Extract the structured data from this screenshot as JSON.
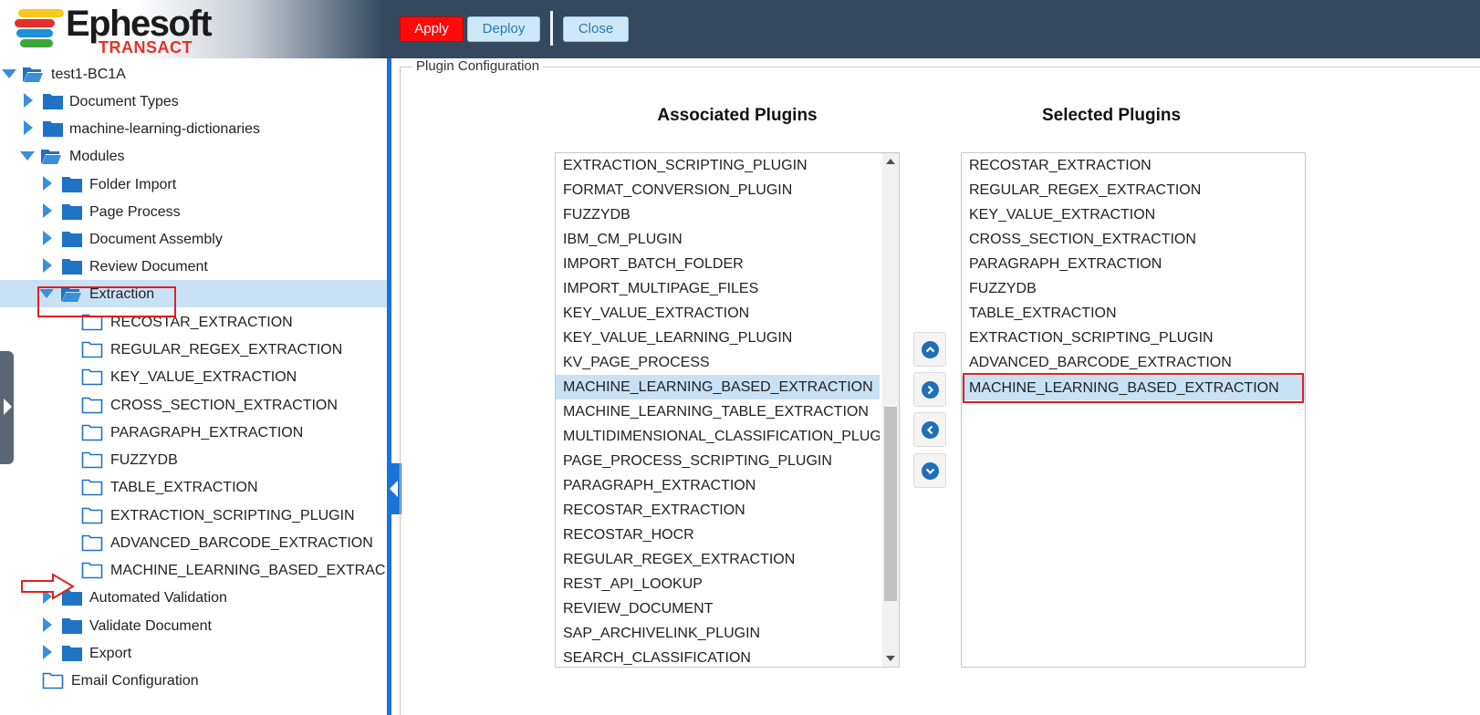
{
  "app": {
    "logo_word": "Ephesoft",
    "logo_sub": "TRANSACT",
    "colors": {
      "header": "#34495e",
      "apply": "#ff0a0a",
      "accent": "#1a73d9",
      "selection": "#c9e1f4",
      "highlight": "#e02020"
    }
  },
  "toolbar": {
    "apply": "Apply",
    "deploy": "Deploy",
    "close": "Close"
  },
  "tree": {
    "root": "test1-BC1A",
    "document_types": "Document Types",
    "ml_dictionaries": "machine-learning-dictionaries",
    "modules": "Modules",
    "folder_import": "Folder Import",
    "page_process": "Page Process",
    "document_assembly": "Document Assembly",
    "review_document": "Review Document",
    "extraction": "Extraction",
    "extraction_children": [
      "RECOSTAR_EXTRACTION",
      "REGULAR_REGEX_EXTRACTION",
      "KEY_VALUE_EXTRACTION",
      "CROSS_SECTION_EXTRACTION",
      "PARAGRAPH_EXTRACTION",
      "FUZZYDB",
      "TABLE_EXTRACTION",
      "EXTRACTION_SCRIPTING_PLUGIN",
      "ADVANCED_BARCODE_EXTRACTION",
      "MACHINE_LEARNING_BASED_EXTRAC"
    ],
    "automated_validation": "Automated Validation",
    "validate_document": "Validate Document",
    "export": "Export",
    "email_configuration": "Email Configuration"
  },
  "plugin_config": {
    "legend": "Plugin Configuration",
    "associated_title": "Associated Plugins",
    "selected_title": "Selected Plugins",
    "associated": [
      "EXTRACTION_SCRIPTING_PLUGIN",
      "FORMAT_CONVERSION_PLUGIN",
      "FUZZYDB",
      "IBM_CM_PLUGIN",
      "IMPORT_BATCH_FOLDER",
      "IMPORT_MULTIPAGE_FILES",
      "KEY_VALUE_EXTRACTION",
      "KEY_VALUE_LEARNING_PLUGIN",
      "KV_PAGE_PROCESS",
      "MACHINE_LEARNING_BASED_EXTRACTION",
      "MACHINE_LEARNING_TABLE_EXTRACTION",
      "MULTIDIMENSIONAL_CLASSIFICATION_PLUG",
      "PAGE_PROCESS_SCRIPTING_PLUGIN",
      "PARAGRAPH_EXTRACTION",
      "RECOSTAR_EXTRACTION",
      "RECOSTAR_HOCR",
      "REGULAR_REGEX_EXTRACTION",
      "REST_API_LOOKUP",
      "REVIEW_DOCUMENT",
      "SAP_ARCHIVELINK_PLUGIN",
      "SEARCH_CLASSIFICATION"
    ],
    "selected": [
      "RECOSTAR_EXTRACTION",
      "REGULAR_REGEX_EXTRACTION",
      "KEY_VALUE_EXTRACTION",
      "CROSS_SECTION_EXTRACTION",
      "PARAGRAPH_EXTRACTION",
      "FUZZYDB",
      "TABLE_EXTRACTION",
      "EXTRACTION_SCRIPTING_PLUGIN",
      "ADVANCED_BARCODE_EXTRACTION",
      "MACHINE_LEARNING_BASED_EXTRACTION"
    ],
    "move_buttons": [
      "chevron-up-icon",
      "chevron-right-icon",
      "chevron-left-icon",
      "chevron-down-icon"
    ]
  }
}
